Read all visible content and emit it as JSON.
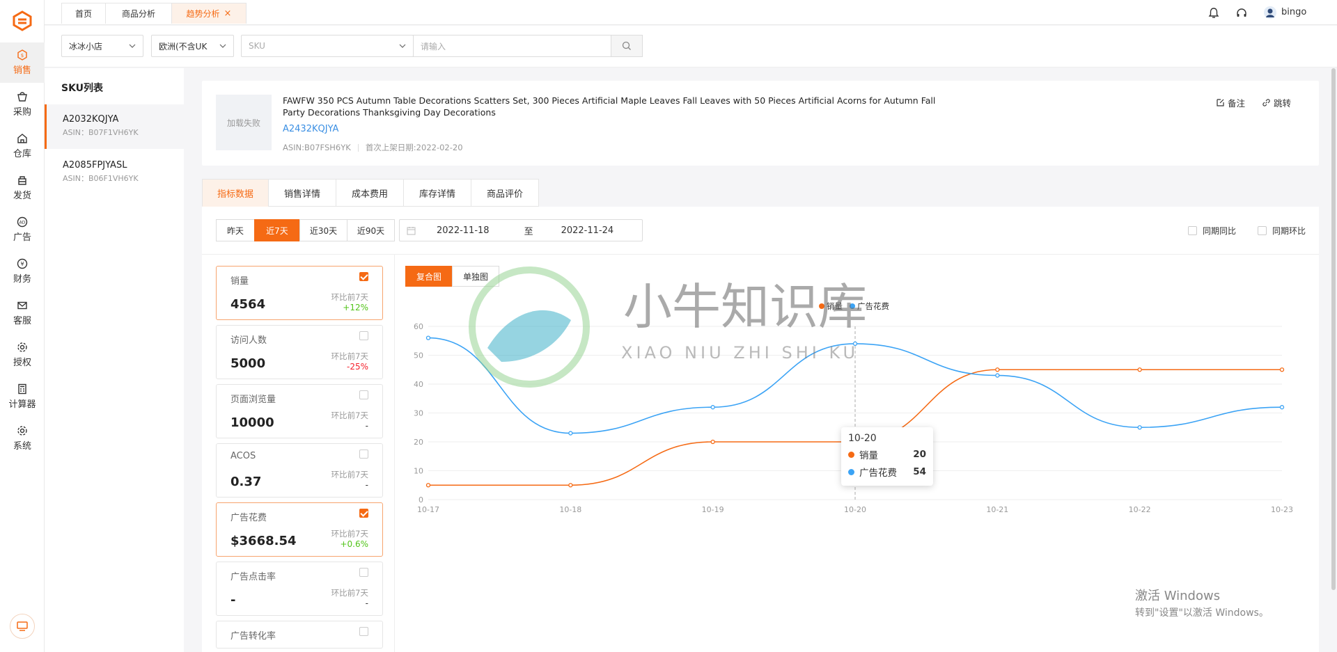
{
  "colors": {
    "accent": "#f56a14",
    "link": "#3b8fe3",
    "series_sales": "#f56a14",
    "series_ad": "#3ba3f5",
    "up": "#52c41a",
    "down": "#f5222d"
  },
  "sidebar": {
    "items": [
      {
        "label": "销售",
        "icon": "sales-icon",
        "active": true
      },
      {
        "label": "采购",
        "icon": "cart-icon"
      },
      {
        "label": "仓库",
        "icon": "warehouse-icon"
      },
      {
        "label": "发货",
        "icon": "shipping-icon"
      },
      {
        "label": "广告",
        "icon": "ad-icon"
      },
      {
        "label": "财务",
        "icon": "finance-icon"
      },
      {
        "label": "客服",
        "icon": "mail-icon"
      },
      {
        "label": "授权",
        "icon": "gear-icon"
      },
      {
        "label": "计算器",
        "icon": "calculator-icon"
      },
      {
        "label": "系统",
        "icon": "settings-icon"
      }
    ]
  },
  "topbar": {
    "tabs": [
      {
        "label": "首页"
      },
      {
        "label": "商品分析"
      },
      {
        "label": "趋势分析",
        "active": true
      }
    ],
    "close": "×",
    "username": "bingo"
  },
  "filters": {
    "shop": "冰冰小店",
    "region": "欧洲(不含UK",
    "sku_placeholder": "SKU",
    "search_placeholder": "请输入"
  },
  "sku_list": {
    "title": "SKU列表",
    "items": [
      {
        "sku": "A2032KQJYA",
        "asin": "ASIN：B07F1VH6YK",
        "active": true
      },
      {
        "sku": "A2085FPJYASL",
        "asin": "ASIN：B06F1VH6YK"
      }
    ]
  },
  "product": {
    "thumb_text": "加载失败",
    "title": "FAWFW 350 PCS Autumn Table Decorations Scatters Set, 300 Pieces Artificial Maple Leaves Fall Leaves with 50 Pieces Artificial Acorns for Autumn Fall Party Decorations Thanksgiving Day Decorations",
    "sku": "A2432KQJYA",
    "asin": "ASIN:B07FSH6YK",
    "first_listed": "首次上架日期:2022-02-20",
    "note_label": "备注",
    "jump_label": "跳转"
  },
  "detail_tabs": [
    {
      "label": "指标数据",
      "active": true
    },
    {
      "label": "销售详情"
    },
    {
      "label": "成本费用"
    },
    {
      "label": "库存详情"
    },
    {
      "label": "商品评价"
    }
  ],
  "range": {
    "buttons": [
      {
        "label": "昨天"
      },
      {
        "label": "近7天",
        "active": true
      },
      {
        "label": "近30天"
      },
      {
        "label": "近90天"
      }
    ],
    "start": "2022-11-18",
    "sep": "至",
    "end": "2022-11-24"
  },
  "compare": {
    "yoy": "同期同比",
    "mom": "同期环比"
  },
  "metrics": [
    {
      "name": "销量",
      "value": "4564",
      "cmp": "环比前7天",
      "delta": "+12%",
      "trend": "up",
      "checked": true
    },
    {
      "name": "访问人数",
      "value": "5000",
      "cmp": "环比前7天",
      "delta": "-25%",
      "trend": "down",
      "checked": false
    },
    {
      "name": "页面浏览量",
      "value": "10000",
      "cmp": "环比前7天",
      "delta": "-",
      "trend": "flat",
      "checked": false
    },
    {
      "name": "ACOS",
      "value": "0.37",
      "cmp": "环比前7天",
      "delta": "-",
      "trend": "flat",
      "checked": false
    },
    {
      "name": "广告花费",
      "value": "$3668.54",
      "cmp": "环比前7天",
      "delta": "+0.6%",
      "trend": "up",
      "checked": true
    },
    {
      "name": "广告点击率",
      "value": "-",
      "cmp": "环比前7天",
      "delta": "-",
      "trend": "flat",
      "checked": false
    },
    {
      "name": "广告转化率",
      "value": "",
      "cmp": "",
      "delta": "",
      "trend": "flat",
      "checked": false
    }
  ],
  "chart_toggle": {
    "combined": "复合图",
    "single": "单独图"
  },
  "chart_data": {
    "type": "line",
    "categories": [
      "10-17",
      "10-18",
      "10-19",
      "10-20",
      "10-21",
      "10-22",
      "10-23"
    ],
    "series": [
      {
        "name": "销量",
        "values": [
          5,
          5,
          20,
          20,
          45,
          45,
          45
        ]
      },
      {
        "name": "广告花费",
        "values": [
          56,
          23,
          32,
          54,
          43,
          25,
          32
        ]
      }
    ],
    "ylim": [
      0,
      60
    ],
    "yticks": [
      0,
      10,
      20,
      30,
      40,
      50,
      60
    ],
    "legend": "top-center",
    "grid": true,
    "smooth": true
  },
  "tooltip": {
    "date": "10-20",
    "rows": [
      {
        "name": "销量",
        "value": "20"
      },
      {
        "name": "广告花费",
        "value": "54"
      }
    ]
  },
  "watermark": {
    "title": "小牛知识库",
    "subtitle": "XIAO NIU ZHI SHI KU"
  },
  "windows_activation": {
    "title": "激活 Windows",
    "subtitle": "转到\"设置\"以激活 Windows。"
  }
}
